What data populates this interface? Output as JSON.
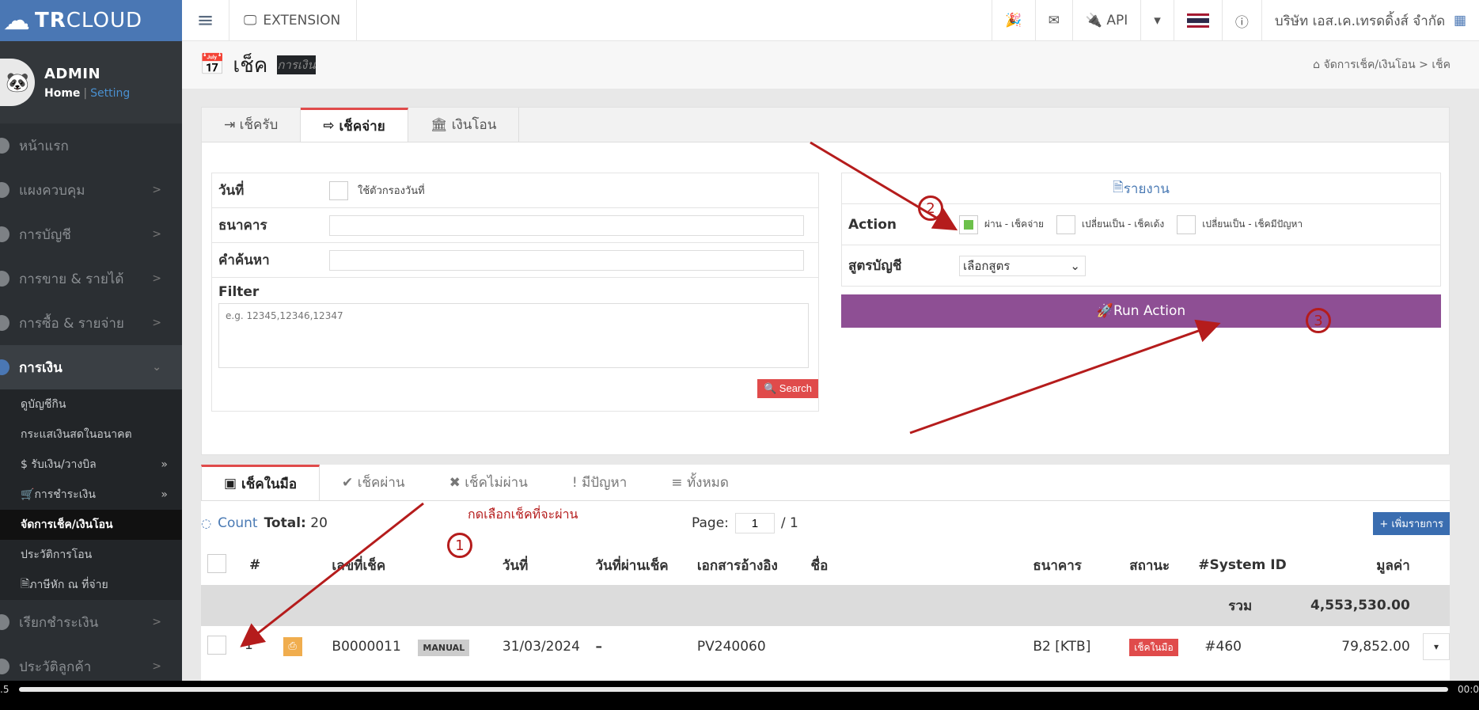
{
  "brand": {
    "name_bold": "TR",
    "name_rest": "CLOUD"
  },
  "user": {
    "name": "ADMIN",
    "home": "Home",
    "sep": "|",
    "setting": "Setting"
  },
  "nav": [
    {
      "label": "หน้าแรก"
    },
    {
      "label": "แผงควบคุม",
      "chev": ">"
    },
    {
      "label": "การบัญชี",
      "chev": ">"
    },
    {
      "label": "การขาย & รายได้",
      "chev": ">"
    },
    {
      "label": "การซื้อ & รายจ่าย",
      "chev": ">"
    },
    {
      "label": "การเงิน",
      "chev": "⌄"
    }
  ],
  "subnav": [
    {
      "label": "ดูบัญชีกิน"
    },
    {
      "label": "กระแสเงินสดในอนาคต"
    },
    {
      "label": "$ รับเงิน/วางบิล",
      "chev": "»"
    },
    {
      "label": "การชำระเงิน",
      "chev": "»"
    },
    {
      "label": "จัดการเช็ค/เงินโอน"
    },
    {
      "label": "ประวัติการโอน"
    },
    {
      "label": "ภาษีหัก ณ ที่จ่าย"
    }
  ],
  "nav2": [
    {
      "label": "เรียกชำระเงิน",
      "chev": ">"
    },
    {
      "label": "ประวัติลูกค้า",
      "chev": ">"
    }
  ],
  "topbar": {
    "extension": "EXTENSION",
    "api": "API",
    "company": "บริษัท เอส.เค.เทรดดิ้งส์ จำกัด"
  },
  "header": {
    "title": "เช็ค",
    "subtitle": "การเงิน",
    "breadcrumb": "จัดการเช็ค/เงินโอน  >  เช็ค"
  },
  "tabs_top": [
    {
      "label": "เช็ครับ",
      "icon": "⇥"
    },
    {
      "label": "เช็คจ่าย",
      "icon": "⇨"
    },
    {
      "label": "เงินโอน",
      "icon": "🏛"
    }
  ],
  "filter": {
    "date_label": "วันที่",
    "date_filter": "ใช้ตัวกรองวันที่",
    "bank_label": "ธนาคาร",
    "search_label": "คำค้นหา",
    "filter_label": "Filter",
    "filter_placeholder": "e.g. 12345,12346,12347",
    "search_button": "Search"
  },
  "action": {
    "report": "รายงาน",
    "action_label": "Action",
    "options": [
      "ผ่าน - เช็คจ่าย",
      "เปลี่ยนเป็น - เช็คเด้ง",
      "เปลี่ยนเป็น - เช็คมีปัญหา"
    ],
    "formula_label": "สูตรบัญชี",
    "formula_select": "เลือกสูตร",
    "run_button": "Run Action"
  },
  "tabs_list": [
    {
      "label": "เช็คในมือ",
      "icon": "▣"
    },
    {
      "label": "เช็คผ่าน",
      "icon": "✔"
    },
    {
      "label": "เช็คไม่ผ่าน",
      "icon": "✖"
    },
    {
      "label": "มีปัญหา",
      "icon": "!"
    },
    {
      "label": "ทั้งหมด",
      "icon": "≡"
    }
  ],
  "list": {
    "count_label": "Count",
    "total_label": "Total:",
    "total_value": "20",
    "page_label": "Page:",
    "page_value": "1",
    "page_total": "/ 1",
    "add_button": "+ เพิ่มรายการ",
    "columns": [
      "#",
      "เลขที่เช็ค",
      "วันที่",
      "วันที่ผ่านเช็ค",
      "เอกสารอ้างอิง",
      "ชื่อ",
      "ธนาคาร",
      "สถานะ",
      "#System ID",
      "มูลค่า"
    ],
    "sum_label": "รวม",
    "sum_value": "4,553,530.00",
    "rows": [
      {
        "no": "1",
        "cheque": "B0000011",
        "type": "MANUAL",
        "date": "31/03/2024",
        "pass_date": "–",
        "ref": "PV240060",
        "name": "",
        "bank": "B2 [KTB]",
        "status": "เช็คในมือ",
        "sysid": "#460",
        "amount": "79,852.00"
      }
    ]
  },
  "annotations": {
    "note": "กดเลือกเช็คที่จะผ่าน",
    "steps": [
      "1",
      "2",
      "3"
    ]
  },
  "player": {
    "left": ".5",
    "right": "00:0"
  }
}
